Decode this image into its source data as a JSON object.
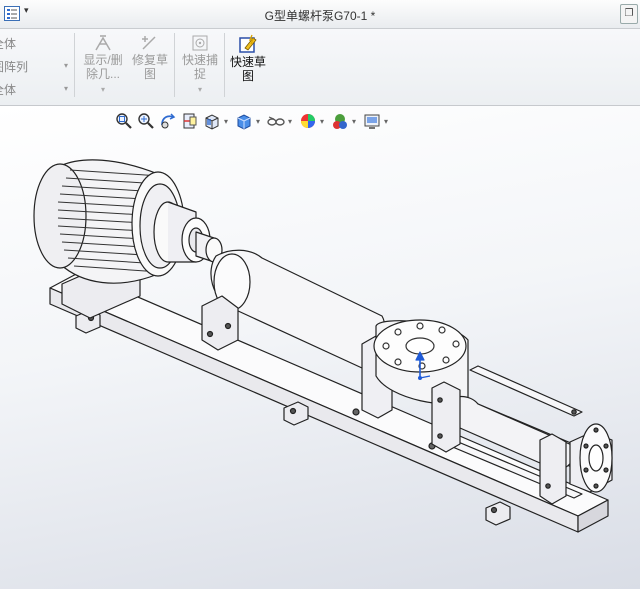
{
  "window": {
    "title": "G型单螺杆泵G70-1 *",
    "quick_access_arrow": "▾",
    "restore_icon": "restore-icon"
  },
  "ribbon": {
    "left_rows": [
      "全体",
      "图阵列",
      "全体"
    ],
    "groups": [
      {
        "name": "show-hide-relations",
        "label_line1": "显示/删",
        "label_line2": "除几...",
        "enabled": false,
        "icon": "relations-icon"
      },
      {
        "name": "repair-sketch",
        "label_line1": "修复草",
        "label_line2": "图",
        "enabled": false,
        "icon": "repair-sketch-icon"
      },
      {
        "name": "quick-snaps",
        "label_line1": "快速捕",
        "label_line2": "捉",
        "enabled": false,
        "icon": "quick-snap-icon"
      },
      {
        "name": "rapid-sketch",
        "label_line1": "快速草",
        "label_line2": "图",
        "enabled": true,
        "icon": "rapid-sketch-icon"
      }
    ]
  },
  "heads_up_toolbar": [
    "zoom-to-fit-icon",
    "zoom-to-area-icon",
    "previous-view-icon",
    "section-view-icon",
    "view-orientation-icon",
    "display-style-icon",
    "hide-show-items-icon",
    "edit-appearance-icon",
    "apply-scene-icon",
    "view-settings-icon"
  ],
  "colors": {
    "accent": "#1e5bd8",
    "model_fill": "#f7f7f9",
    "model_edge": "#222222"
  }
}
